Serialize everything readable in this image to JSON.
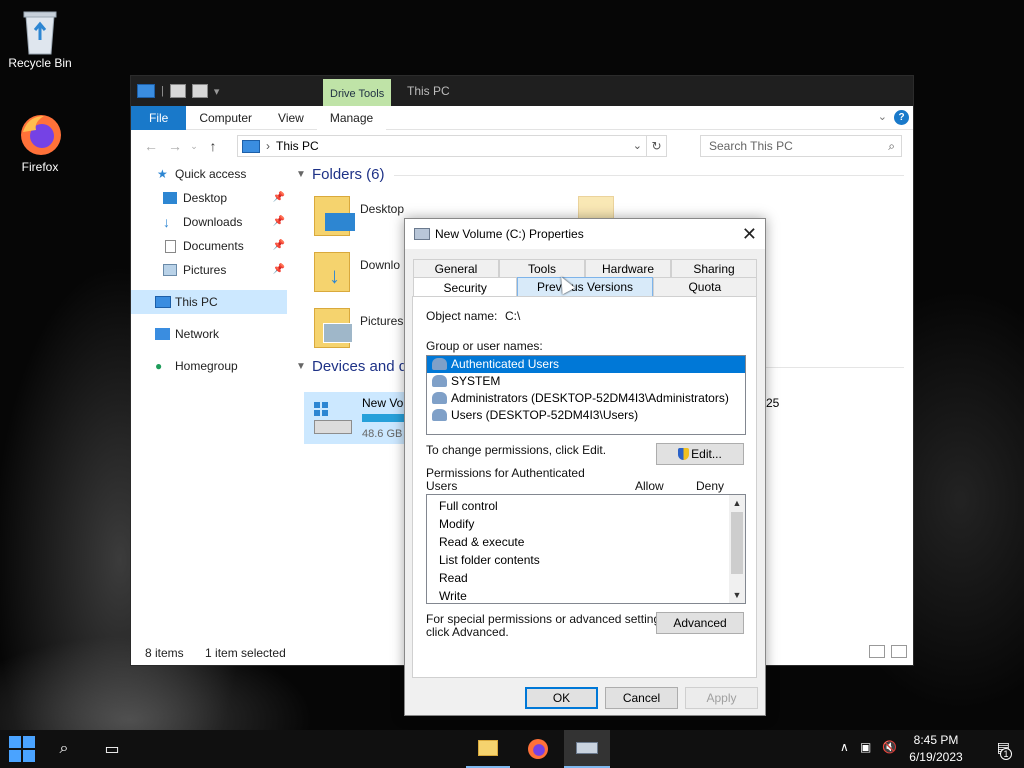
{
  "desktop": {
    "icons": [
      {
        "label": "Recycle Bin",
        "icon": "recycle-bin-icon"
      },
      {
        "label": "Firefox",
        "icon": "firefox-icon"
      }
    ]
  },
  "explorer": {
    "title": "This PC",
    "drive_tools": "Drive Tools",
    "ribbon_tabs": [
      "File",
      "Computer",
      "View",
      "Manage"
    ],
    "address": "This PC",
    "search_placeholder": "Search This PC",
    "nav": {
      "quick_access": "Quick access",
      "quick_items": [
        "Desktop",
        "Downloads",
        "Documents",
        "Pictures"
      ],
      "this_pc": "This PC",
      "network": "Network",
      "homegroup": "Homegroup"
    },
    "folders_header": "Folders (6)",
    "folders": [
      "Desktop",
      "Downlo",
      "Pictures"
    ],
    "devices_header": "Devices and d",
    "drive": {
      "label": "New Vol",
      "free": "48.6 GB",
      "extra": "25"
    },
    "status": {
      "items": "8 items",
      "selected": "1 item selected"
    }
  },
  "dialog": {
    "title": "New Volume (C:) Properties",
    "tabs_top": [
      "General",
      "Tools",
      "Hardware",
      "Sharing"
    ],
    "tabs_bottom": [
      "Security",
      "Previous Versions",
      "Quota"
    ],
    "object_name_label": "Object name:",
    "object_name_value": "C:\\",
    "group_label": "Group or user names:",
    "users": [
      "Authenticated Users",
      "SYSTEM",
      "Administrators (DESKTOP-52DM4I3\\Administrators)",
      "Users (DESKTOP-52DM4I3\\Users)"
    ],
    "change_text": "To change permissions, click Edit.",
    "edit_button": "Edit...",
    "perm_label_line1": "Permissions for Authenticated",
    "perm_label_line2": "Users",
    "allow": "Allow",
    "deny": "Deny",
    "permissions": [
      "Full control",
      "Modify",
      "Read & execute",
      "List folder contents",
      "Read",
      "Write"
    ],
    "special_line1": "For special permissions or advanced settings,",
    "special_line2": "click Advanced.",
    "advanced_button": "Advanced",
    "ok": "OK",
    "cancel": "Cancel",
    "apply": "Apply"
  },
  "taskbar": {
    "time": "8:45 PM",
    "date": "6/19/2023",
    "notifications": "1"
  }
}
